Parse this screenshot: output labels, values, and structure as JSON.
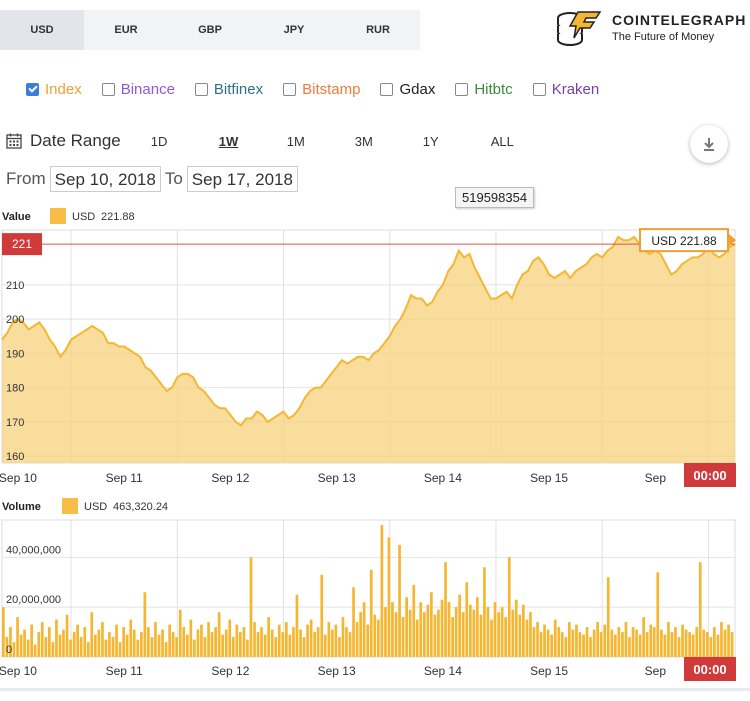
{
  "currencies": [
    "USD",
    "EUR",
    "GBP",
    "JPY",
    "RUR"
  ],
  "active_currency": "USD",
  "brand": {
    "name": "COINTELEGRAPH",
    "tagline": "The Future of Money"
  },
  "exchanges": [
    {
      "label": "Index",
      "checked": true,
      "color": "#f0a030"
    },
    {
      "label": "Binance",
      "checked": false,
      "color": "#8a5cd6"
    },
    {
      "label": "Bitfinex",
      "checked": false,
      "color": "#2f6f8f"
    },
    {
      "label": "Bitstamp",
      "checked": false,
      "color": "#f07a3a"
    },
    {
      "label": "Gdax",
      "checked": false,
      "color": "#222222"
    },
    {
      "label": "Hitbtc",
      "checked": false,
      "color": "#3a8a3a"
    },
    {
      "label": "Kraken",
      "checked": false,
      "color": "#7a3fa0"
    }
  ],
  "range": {
    "label": "Date Range",
    "buttons": [
      "1D",
      "1W",
      "1M",
      "3M",
      "1Y",
      "ALL"
    ],
    "active": "1W",
    "from_label": "From",
    "from": "Sep 10, 2018",
    "to_label": "To",
    "to": "Sep 17, 2018"
  },
  "tooltip_id": "519598354",
  "chart_data": [
    {
      "type": "area",
      "title": "Value",
      "legend": "USD",
      "legend_value": "221.88",
      "current_label": "221",
      "flag_label": "USD 221.88",
      "ylim": [
        158,
        226
      ],
      "yticks": [
        160,
        170,
        180,
        190,
        200,
        210
      ],
      "xticks": [
        "Sep 10",
        "Sep 11",
        "Sep 12",
        "Sep 13",
        "Sep 14",
        "Sep 15",
        "Sep"
      ],
      "x_positions": [
        0,
        1,
        2,
        3,
        4,
        5,
        6
      ],
      "xlim": [
        -0.15,
        6.75
      ],
      "time_badge": "00:00",
      "color": "#f7bd47",
      "points": [
        [
          -0.15,
          194
        ],
        [
          -0.1,
          196
        ],
        [
          -0.05,
          199
        ],
        [
          0.0,
          200
        ],
        [
          0.05,
          199
        ],
        [
          0.1,
          197
        ],
        [
          0.15,
          198
        ],
        [
          0.2,
          199
        ],
        [
          0.25,
          197
        ],
        [
          0.3,
          194
        ],
        [
          0.35,
          192
        ],
        [
          0.4,
          189
        ],
        [
          0.45,
          191
        ],
        [
          0.5,
          194
        ],
        [
          0.55,
          195
        ],
        [
          0.6,
          196
        ],
        [
          0.65,
          197
        ],
        [
          0.7,
          198
        ],
        [
          0.75,
          197
        ],
        [
          0.8,
          196
        ],
        [
          0.85,
          193
        ],
        [
          0.9,
          193
        ],
        [
          0.95,
          192
        ],
        [
          1.0,
          192
        ],
        [
          1.05,
          191
        ],
        [
          1.1,
          190
        ],
        [
          1.15,
          189
        ],
        [
          1.2,
          186
        ],
        [
          1.25,
          185
        ],
        [
          1.3,
          183
        ],
        [
          1.35,
          181
        ],
        [
          1.4,
          179
        ],
        [
          1.45,
          180
        ],
        [
          1.5,
          183
        ],
        [
          1.55,
          184
        ],
        [
          1.6,
          184
        ],
        [
          1.65,
          183
        ],
        [
          1.7,
          180
        ],
        [
          1.75,
          179
        ],
        [
          1.8,
          177
        ],
        [
          1.85,
          175
        ],
        [
          1.9,
          174
        ],
        [
          1.95,
          174
        ],
        [
          2.0,
          172
        ],
        [
          2.05,
          170
        ],
        [
          2.1,
          169
        ],
        [
          2.15,
          171
        ],
        [
          2.2,
          171
        ],
        [
          2.25,
          173
        ],
        [
          2.3,
          172
        ],
        [
          2.35,
          170
        ],
        [
          2.4,
          171
        ],
        [
          2.45,
          172
        ],
        [
          2.5,
          173
        ],
        [
          2.55,
          171
        ],
        [
          2.6,
          172
        ],
        [
          2.65,
          174
        ],
        [
          2.7,
          177
        ],
        [
          2.75,
          179
        ],
        [
          2.8,
          180
        ],
        [
          2.85,
          180
        ],
        [
          2.9,
          182
        ],
        [
          2.95,
          184
        ],
        [
          3.0,
          186
        ],
        [
          3.05,
          188
        ],
        [
          3.1,
          187
        ],
        [
          3.15,
          188
        ],
        [
          3.2,
          189
        ],
        [
          3.25,
          189
        ],
        [
          3.3,
          188
        ],
        [
          3.35,
          190
        ],
        [
          3.4,
          191
        ],
        [
          3.45,
          193
        ],
        [
          3.5,
          195
        ],
        [
          3.55,
          198
        ],
        [
          3.6,
          200
        ],
        [
          3.65,
          203
        ],
        [
          3.7,
          207
        ],
        [
          3.75,
          206
        ],
        [
          3.8,
          206
        ],
        [
          3.85,
          204
        ],
        [
          3.9,
          205
        ],
        [
          3.95,
          208
        ],
        [
          4.0,
          210
        ],
        [
          4.05,
          214
        ],
        [
          4.1,
          216
        ],
        [
          4.15,
          220
        ],
        [
          4.2,
          218
        ],
        [
          4.25,
          219
        ],
        [
          4.3,
          215
        ],
        [
          4.35,
          212
        ],
        [
          4.4,
          209
        ],
        [
          4.45,
          206
        ],
        [
          4.5,
          206
        ],
        [
          4.55,
          207
        ],
        [
          4.6,
          208
        ],
        [
          4.65,
          206
        ],
        [
          4.7,
          210
        ],
        [
          4.75,
          213
        ],
        [
          4.8,
          214
        ],
        [
          4.85,
          217
        ],
        [
          4.9,
          218
        ],
        [
          4.95,
          216
        ],
        [
          5.0,
          213
        ],
        [
          5.05,
          212
        ],
        [
          5.1,
          213
        ],
        [
          5.15,
          214
        ],
        [
          5.2,
          212
        ],
        [
          5.25,
          214
        ],
        [
          5.3,
          215
        ],
        [
          5.35,
          216
        ],
        [
          5.4,
          218
        ],
        [
          5.45,
          219
        ],
        [
          5.5,
          218
        ],
        [
          5.55,
          220
        ],
        [
          5.6,
          221
        ],
        [
          5.65,
          224
        ],
        [
          5.7,
          223
        ],
        [
          5.75,
          223
        ],
        [
          5.8,
          224
        ],
        [
          5.85,
          222
        ],
        [
          5.9,
          220
        ],
        [
          5.95,
          219
        ],
        [
          6.0,
          220
        ],
        [
          6.05,
          219
        ],
        [
          6.1,
          216
        ],
        [
          6.15,
          213
        ],
        [
          6.2,
          214
        ],
        [
          6.25,
          216
        ],
        [
          6.3,
          217
        ],
        [
          6.35,
          218
        ],
        [
          6.4,
          218
        ],
        [
          6.45,
          219
        ],
        [
          6.5,
          221
        ],
        [
          6.55,
          219
        ],
        [
          6.6,
          218
        ],
        [
          6.65,
          219
        ],
        [
          6.7,
          221
        ],
        [
          6.75,
          221.88
        ]
      ]
    },
    {
      "type": "bar",
      "title": "Volume",
      "legend": "USD",
      "legend_value": "463,320.24",
      "ylim": [
        0,
        55000000
      ],
      "yticks": [
        0,
        20000000,
        40000000
      ],
      "ytick_labels": [
        "0",
        "20,000,000",
        "40,000,000"
      ],
      "xticks": [
        "Sep 10",
        "Sep 11",
        "Sep 12",
        "Sep 13",
        "Sep 14",
        "Sep 15",
        "Sep"
      ],
      "x_positions": [
        0,
        1,
        2,
        3,
        4,
        5,
        6
      ],
      "xlim": [
        -0.15,
        6.75
      ],
      "time_badge": "00:00",
      "color": "#f7bd47",
      "bar_start": -0.15,
      "bar_step": 0.0333,
      "values": [
        20,
        8,
        12,
        6,
        16,
        9,
        11,
        7,
        13,
        5,
        10,
        14,
        8,
        12,
        6,
        15,
        9,
        11,
        17,
        7,
        10,
        13,
        8,
        12,
        6,
        18,
        9,
        11,
        14,
        7,
        10,
        8,
        13,
        6,
        12,
        9,
        15,
        11,
        7,
        10,
        26,
        12,
        8,
        14,
        9,
        11,
        6,
        13,
        10,
        8,
        19,
        12,
        9,
        15,
        7,
        11,
        13,
        8,
        14,
        10,
        12,
        18,
        9,
        11,
        15,
        8,
        13,
        10,
        12,
        7,
        40,
        14,
        10,
        12,
        9,
        16,
        11,
        8,
        13,
        10,
        14,
        9,
        12,
        25,
        11,
        8,
        13,
        15,
        10,
        12,
        33,
        9,
        14,
        11,
        13,
        8,
        16,
        12,
        10,
        28,
        14,
        18,
        22,
        13,
        35,
        17,
        15,
        53,
        20,
        48,
        22,
        18,
        45,
        16,
        24,
        19,
        29,
        15,
        22,
        18,
        21,
        26,
        17,
        19,
        23,
        38,
        22,
        16,
        20,
        25,
        18,
        30,
        21,
        19,
        24,
        17,
        36,
        20,
        15,
        22,
        18,
        20,
        16,
        40,
        19,
        23,
        17,
        21,
        15,
        18,
        12,
        14,
        10,
        13,
        11,
        9,
        15,
        12,
        10,
        8,
        14,
        11,
        13,
        10,
        9,
        12,
        8,
        11,
        14,
        10,
        13,
        32,
        11,
        9,
        12,
        10,
        14,
        8,
        12,
        11,
        9,
        16,
        10,
        13,
        12,
        34,
        11,
        9,
        14,
        10,
        12,
        8,
        13,
        11,
        10,
        9,
        12,
        38,
        11,
        10,
        8,
        12,
        9,
        14,
        11,
        13,
        10,
        12,
        9,
        15,
        11
      ]
    }
  ]
}
